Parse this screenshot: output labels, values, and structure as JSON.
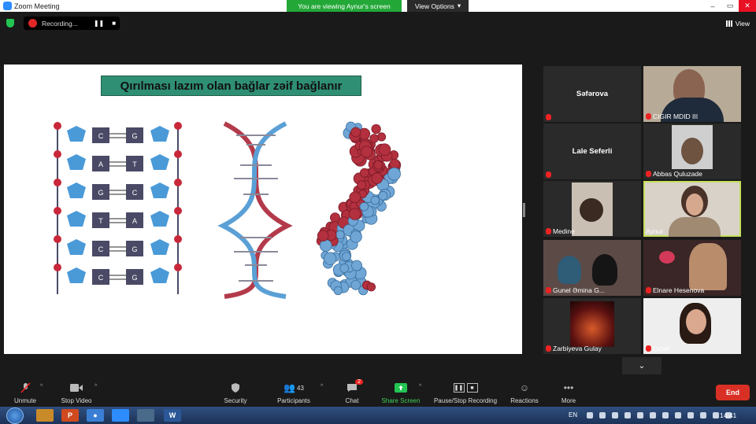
{
  "window": {
    "title": "Zoom Meeting",
    "viewing_banner": "You are viewing Aynur's screen",
    "view_options": "View Options"
  },
  "topbar": {
    "recording": "Recording...",
    "view_label": "View"
  },
  "slide": {
    "title": "Qırılması lazım olan bağlar zəif bağlanır",
    "base_pairs": [
      [
        "C",
        "G"
      ],
      [
        "A",
        "T"
      ],
      [
        "G",
        "C"
      ],
      [
        "T",
        "A"
      ],
      [
        "C",
        "G"
      ],
      [
        "C",
        "G"
      ]
    ]
  },
  "participants": [
    {
      "name": "Səfərova",
      "label": "",
      "type": "name"
    },
    {
      "name": "",
      "label": "CIGIR MDID III",
      "type": "video"
    },
    {
      "name": "Lale Seferli",
      "label": "",
      "type": "name"
    },
    {
      "name": "",
      "label": "Abbas Quluzade",
      "type": "video"
    },
    {
      "name": "",
      "label": "Medine",
      "type": "video"
    },
    {
      "name": "",
      "label": "Aynur",
      "type": "video"
    },
    {
      "name": "",
      "label": "Gunel Əmina G...",
      "type": "video"
    },
    {
      "name": "",
      "label": "Elnare Hesenova",
      "type": "video"
    },
    {
      "name": "",
      "label": "Zarbiyeva Gulay",
      "type": "video"
    },
    {
      "name": "",
      "label": "Çiçək",
      "type": "video"
    }
  ],
  "toolbar": {
    "unmute": "Unmute",
    "stop_video": "Stop Video",
    "security": "Security",
    "participants": "Participants",
    "participants_count": "43",
    "chat": "Chat",
    "chat_badge": "2",
    "share_screen": "Share Screen",
    "pause_stop_recording": "Pause/Stop Recording",
    "reactions": "Reactions",
    "more": "More",
    "end": "End"
  },
  "taskbar": {
    "lang": "EN",
    "time": "14:41"
  },
  "colors": {
    "share_green": "#23a838",
    "end_red": "#d93025",
    "active_speaker": "#c5e05a",
    "slide_title_bg": "#2f8f74"
  }
}
